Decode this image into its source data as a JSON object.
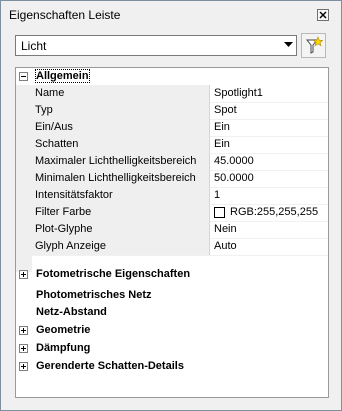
{
  "window": {
    "title": "Eigenschaften Leiste"
  },
  "selector": {
    "value": "Licht"
  },
  "icons": {
    "close": "close-icon",
    "filter": "quick-select-icon",
    "dropdown": "chevron-down-icon"
  },
  "categories": [
    {
      "label": "Allgemein",
      "expanded": true
    },
    {
      "label": "Fotometrische Eigenschaften",
      "expanded": false
    },
    {
      "label": "Photometrisches Netz",
      "expanded": false
    },
    {
      "label": "Netz-Abstand",
      "expanded": false
    },
    {
      "label": "Geometrie",
      "expanded": false
    },
    {
      "label": "Dämpfung",
      "expanded": false
    },
    {
      "label": "Gerenderte Schatten-Details",
      "expanded": false
    }
  ],
  "properties": [
    {
      "name": "Name",
      "value": "Spotlight1"
    },
    {
      "name": "Typ",
      "value": "Spot"
    },
    {
      "name": "Ein/Aus",
      "value": "Ein"
    },
    {
      "name": "Schatten",
      "value": "Ein"
    },
    {
      "name": "Maximaler Lichthelligkeitsbereich",
      "value": "45.0000"
    },
    {
      "name": "Minimalen Lichthelligkeitsbereich",
      "value": "50.0000"
    },
    {
      "name": "Intensitätsfaktor",
      "value": "1"
    },
    {
      "name": "Filter Farbe",
      "value": "RGB:255,255,255",
      "swatch": "#ffffff"
    },
    {
      "name": "Plot-Glyphe",
      "value": "Nein"
    },
    {
      "name": "Glyph Anzeige",
      "value": "Auto"
    }
  ]
}
